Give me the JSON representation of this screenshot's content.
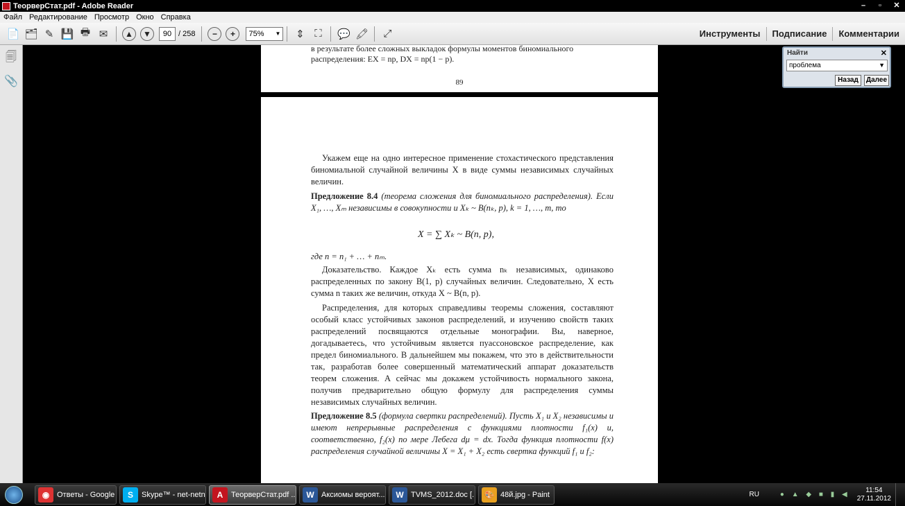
{
  "window": {
    "title": "ТеорверСтат.pdf - Adobe Reader"
  },
  "menu": [
    "Файл",
    "Редактирование",
    "Просмотр",
    "Окно",
    "Справка"
  ],
  "toolbar": {
    "page_current": "90",
    "page_total": "/ 258",
    "zoom": "75%",
    "right_tabs": [
      "Инструменты",
      "Подписание",
      "Комментарии"
    ]
  },
  "find": {
    "title": "Найти",
    "query": "проблема",
    "back_label": "Назад",
    "next_label": "Далее"
  },
  "page_top": {
    "line1": "в результате более сложных выкладок формулы моментов биномиального",
    "line2": "распределения: EX = np,  DX = np(1 − p).",
    "page_number": "89"
  },
  "page_main": {
    "p1": "Укажем еще на одно интересное применение стохастического представления биномиальной случайной величины X в виде суммы независимых случайных величин.",
    "prop1_head": "Предложение 8.4",
    "prop1_text": "(теорема сложения для биномиального распределения). Если X₁, …, Xₘ независимы в совокупности и Xₖ ~ B(nₖ, p), k = 1, …, m, то",
    "formula1": "X = ∑ Xₖ ~ B(n, p),",
    "where": "где n = n₁ + … + nₘ.",
    "proof": "Доказательство. Каждое Xₖ есть сумма nₖ независимых, одинаково распределенных по закону B(1, p) случайных величин. Следовательно, X есть сумма n таких же величин, откуда X ~ B(n, p).",
    "p2": "Распределения, для которых справедливы теоремы сложения, составляют особый класс устойчивых законов распределений, и изучению свойств таких распределений посвящаются отдельные монографии. Вы, наверное, догадываетесь, что устойчивым является пуассоновское распределение, как предел биномиального. В дальнейшем мы покажем, что это в действительности так, разработав более совершенный математический аппарат доказательств теорем сложения. А сейчас мы докажем устойчивость нормального закона, получив предварительно общую формулу для распределения суммы независимых случайных величин.",
    "prop2_head": "Предложение 8.5",
    "prop2_text": "(формула свертки распределений). Пусть X₁ и X₂ независимы и имеют непрерывные распределения с функциями плотности f₁(x) и, соответственно, f₂(x) по мере Лебега dμ = dx. Тогда функция плотности f(x) распределения случайной величины X = X₁ + X₂ есть свертка функций f₁ и f₂:"
  },
  "taskbar": {
    "items": [
      {
        "label": "Ответы - Google ...",
        "icon": "chrome-icon",
        "color": "#d33"
      },
      {
        "label": "Skype™ - net-netno",
        "icon": "skype-icon",
        "color": "#00aff0"
      },
      {
        "label": "ТеорверСтат.pdf ...",
        "icon": "pdf-icon",
        "color": "#c3151f"
      },
      {
        "label": "Аксиомы вероят...",
        "icon": "word-icon",
        "color": "#2b5797"
      },
      {
        "label": "TVMS_2012.doc [...",
        "icon": "word-icon",
        "color": "#2b5797"
      },
      {
        "label": "48й.jpg - Paint",
        "icon": "paint-icon",
        "color": "#e8a020"
      }
    ],
    "lang": "RU",
    "time": "11:54",
    "date": "27.11.2012"
  }
}
